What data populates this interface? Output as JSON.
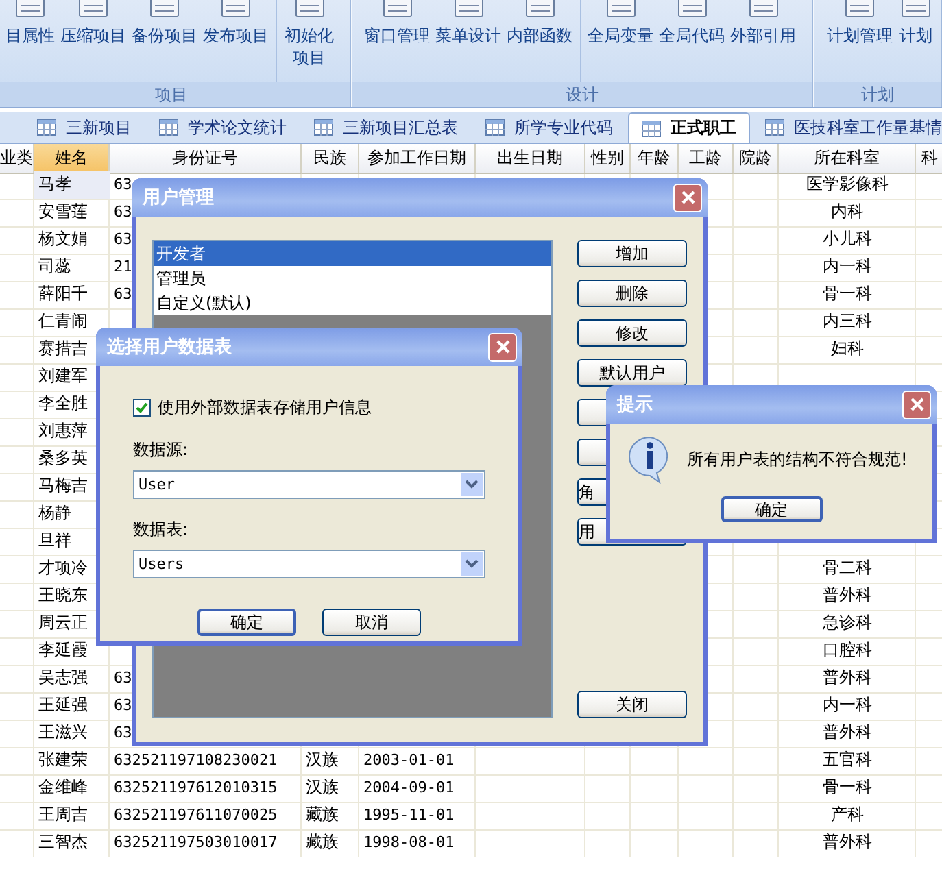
{
  "ribbon": {
    "groups": [
      {
        "label": "项目",
        "sections": [
          [
            {
              "label": "目属性"
            },
            {
              "label": "压缩项目"
            },
            {
              "label": "备份项目"
            },
            {
              "label": "发布项目"
            }
          ],
          [
            {
              "label": "初始化项目",
              "kind": "stacked"
            }
          ]
        ]
      },
      {
        "label": "设计",
        "sections": [
          [
            {
              "label": "窗口管理"
            },
            {
              "label": "菜单设计"
            },
            {
              "label": "内部函数"
            }
          ],
          [
            {
              "label": "全局变量"
            },
            {
              "label": "全局代码"
            },
            {
              "label": "外部引用"
            }
          ]
        ]
      },
      {
        "label": "计划",
        "sections": [
          [
            {
              "label": "计划管理"
            },
            {
              "label": "计划"
            }
          ]
        ]
      }
    ]
  },
  "tabs": [
    {
      "label": "三新项目",
      "selected": false
    },
    {
      "label": "学术论文统计",
      "selected": false
    },
    {
      "label": "三新项目汇总表",
      "selected": false
    },
    {
      "label": "所学专业代码",
      "selected": false
    },
    {
      "label": "正式职工",
      "selected": true
    },
    {
      "label": "医技科室工作量基情",
      "selected": false
    }
  ],
  "table": {
    "columns": [
      {
        "label": "业类",
        "selected": false
      },
      {
        "label": "姓名",
        "selected": true
      },
      {
        "label": "身份证号",
        "selected": false
      },
      {
        "label": "民族",
        "selected": false
      },
      {
        "label": "参加工作日期",
        "selected": false
      },
      {
        "label": "出生日期",
        "selected": false
      },
      {
        "label": "性别",
        "selected": false
      },
      {
        "label": "年龄",
        "selected": false
      },
      {
        "label": "工龄",
        "selected": false
      },
      {
        "label": "院龄",
        "selected": false
      },
      {
        "label": "所在科室",
        "selected": false
      },
      {
        "label": "科",
        "selected": false
      }
    ],
    "rows": [
      {
        "name": "马孝",
        "id": "63",
        "dept": "医学影像科",
        "selected": true
      },
      {
        "name": "安雪莲",
        "id": "63",
        "dept": "内科",
        "selected": false
      },
      {
        "name": "杨文娟",
        "id": "63",
        "dept": "小儿科",
        "selected": false
      },
      {
        "name": "司蕊",
        "id": "21",
        "dept": "内一科",
        "selected": false
      },
      {
        "name": "薛阳千",
        "id": "63",
        "dept": "骨一科",
        "selected": false
      },
      {
        "name": "仁青闹",
        "dept": "内三科",
        "selected": false
      },
      {
        "name": "赛措吉",
        "dept": "妇科",
        "selected": false
      },
      {
        "name": "刘建军",
        "selected": false
      },
      {
        "name": "李全胜",
        "selected": false
      },
      {
        "name": "刘惠萍",
        "selected": false
      },
      {
        "name": "桑多英",
        "selected": false
      },
      {
        "name": "马梅吉",
        "selected": false
      },
      {
        "name": "杨静",
        "selected": false
      },
      {
        "name": "旦祥",
        "selected": false
      },
      {
        "name": "才项冷",
        "dept": "骨二科",
        "selected": false
      },
      {
        "name": "王晓东",
        "dept": "普外科",
        "selected": false
      },
      {
        "name": "周云正",
        "dept": "急诊科",
        "selected": false
      },
      {
        "name": "李延霞",
        "dept": "口腔科",
        "selected": false
      },
      {
        "name": "吴志强",
        "id": "63",
        "dept": "普外科",
        "selected": false
      },
      {
        "name": "王延强",
        "id": "63",
        "dept": "内一科",
        "selected": false
      },
      {
        "name": "王滋兴",
        "id": "63",
        "dept": "普外科",
        "selected": false
      },
      {
        "name": "张建荣",
        "id": "632521197108230021",
        "ethnicity": "汉族",
        "joined": "2003-01-01",
        "dept": "五官科",
        "selected": false
      },
      {
        "name": "金维峰",
        "id": "632521197612010315",
        "ethnicity": "汉族",
        "joined": "2004-09-01",
        "dept": "骨一科",
        "selected": false
      },
      {
        "name": "王周吉",
        "id": "632521197611070025",
        "ethnicity": "藏族",
        "joined": "1995-11-01",
        "dept": "产科",
        "selected": false
      },
      {
        "name": "三智杰",
        "id": "632521197503010017",
        "ethnicity": "藏族",
        "joined": "1998-08-01",
        "dept": "普外科",
        "selected": false
      }
    ]
  },
  "user_dialog": {
    "title": "用户管理",
    "list": [
      {
        "label": "开发者",
        "selected": true
      },
      {
        "label": "管理员",
        "selected": false
      },
      {
        "label": "自定义(默认)",
        "selected": false
      }
    ],
    "buttons": [
      {
        "kind": "full",
        "label": "增加"
      },
      {
        "kind": "full",
        "label": "删除"
      },
      {
        "kind": "full",
        "label": "修改"
      },
      {
        "kind": "full",
        "label": "默认用户"
      },
      {
        "kind": "blank"
      },
      {
        "kind": "blank"
      },
      {
        "kind": "partial",
        "label": "角"
      },
      {
        "kind": "partial",
        "label": "用"
      }
    ],
    "close_button": "关闭"
  },
  "table_dialog": {
    "title": "选择用户数据表",
    "checkbox": {
      "label": "使用外部数据表存储用户信息",
      "checked": true
    },
    "fields": [
      {
        "label": "数据源:",
        "value": "User"
      },
      {
        "label": "数据表:",
        "value": "Users"
      }
    ],
    "buttons": [
      {
        "label": "确定",
        "default": true
      },
      {
        "label": "取消",
        "default": false
      }
    ]
  },
  "prompt": {
    "title": "提示",
    "message": "所有用户表的结构不符合规范!",
    "button": "确定"
  }
}
